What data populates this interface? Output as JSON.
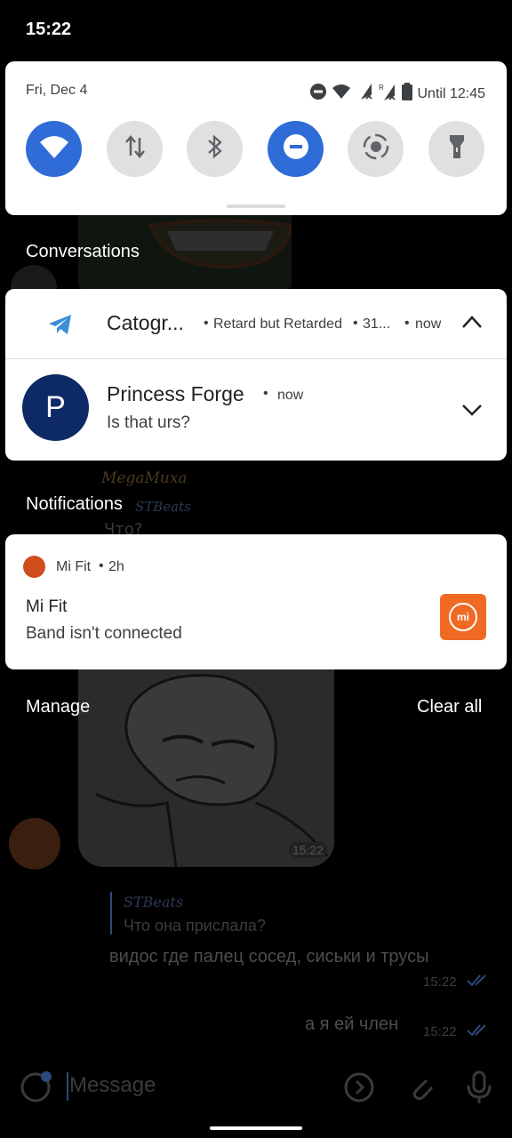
{
  "status_bar": {
    "time": "15:22"
  },
  "quick_settings": {
    "date": "Fri, Dec 4",
    "battery_text": "Until 12:45",
    "tiles": [
      {
        "name": "wifi",
        "state": "on"
      },
      {
        "name": "mobile-data",
        "state": "off"
      },
      {
        "name": "bluetooth",
        "state": "off"
      },
      {
        "name": "do-not-disturb",
        "state": "on"
      },
      {
        "name": "auto-rotate",
        "state": "off"
      },
      {
        "name": "flashlight",
        "state": "off"
      }
    ]
  },
  "conversations": {
    "section_title": "Conversations",
    "telegram": {
      "app": "Catogr...",
      "group": "Retard but Retarded",
      "count": "31...",
      "time": "now"
    },
    "message": {
      "avatar_letter": "P",
      "sender": "Princess Forge",
      "time": "now",
      "text": "Is that urs?"
    }
  },
  "notifications": {
    "section_title": "Notifications",
    "mifit": {
      "app": "Mi Fit",
      "time": "2h",
      "title": "Mi Fit",
      "text": "Band isn't connected",
      "large_icon_text": "mi"
    }
  },
  "footer": {
    "manage": "Manage",
    "clear_all": "Clear all"
  },
  "background_chat": {
    "sender1": "MegaMuxa",
    "reply1_name": "STBeats",
    "reply1_text": "Что?",
    "image_time": "15:22",
    "reply2_name": "STBeats",
    "reply2_text": "Что она прислала?",
    "msg1": "видос где палец сосед, сиськи и трусы",
    "msg1_time": "15:22",
    "msg2": "а я ей член",
    "msg2_time": "15:22",
    "input_placeholder": "Message"
  },
  "colors": {
    "accent": "#2f6cd8",
    "mifit_orange": "#f06a23",
    "mifit_dot": "#d04d1e",
    "avatar_blue": "#0d2a66",
    "telegram_blue": "#3a8fd6"
  }
}
